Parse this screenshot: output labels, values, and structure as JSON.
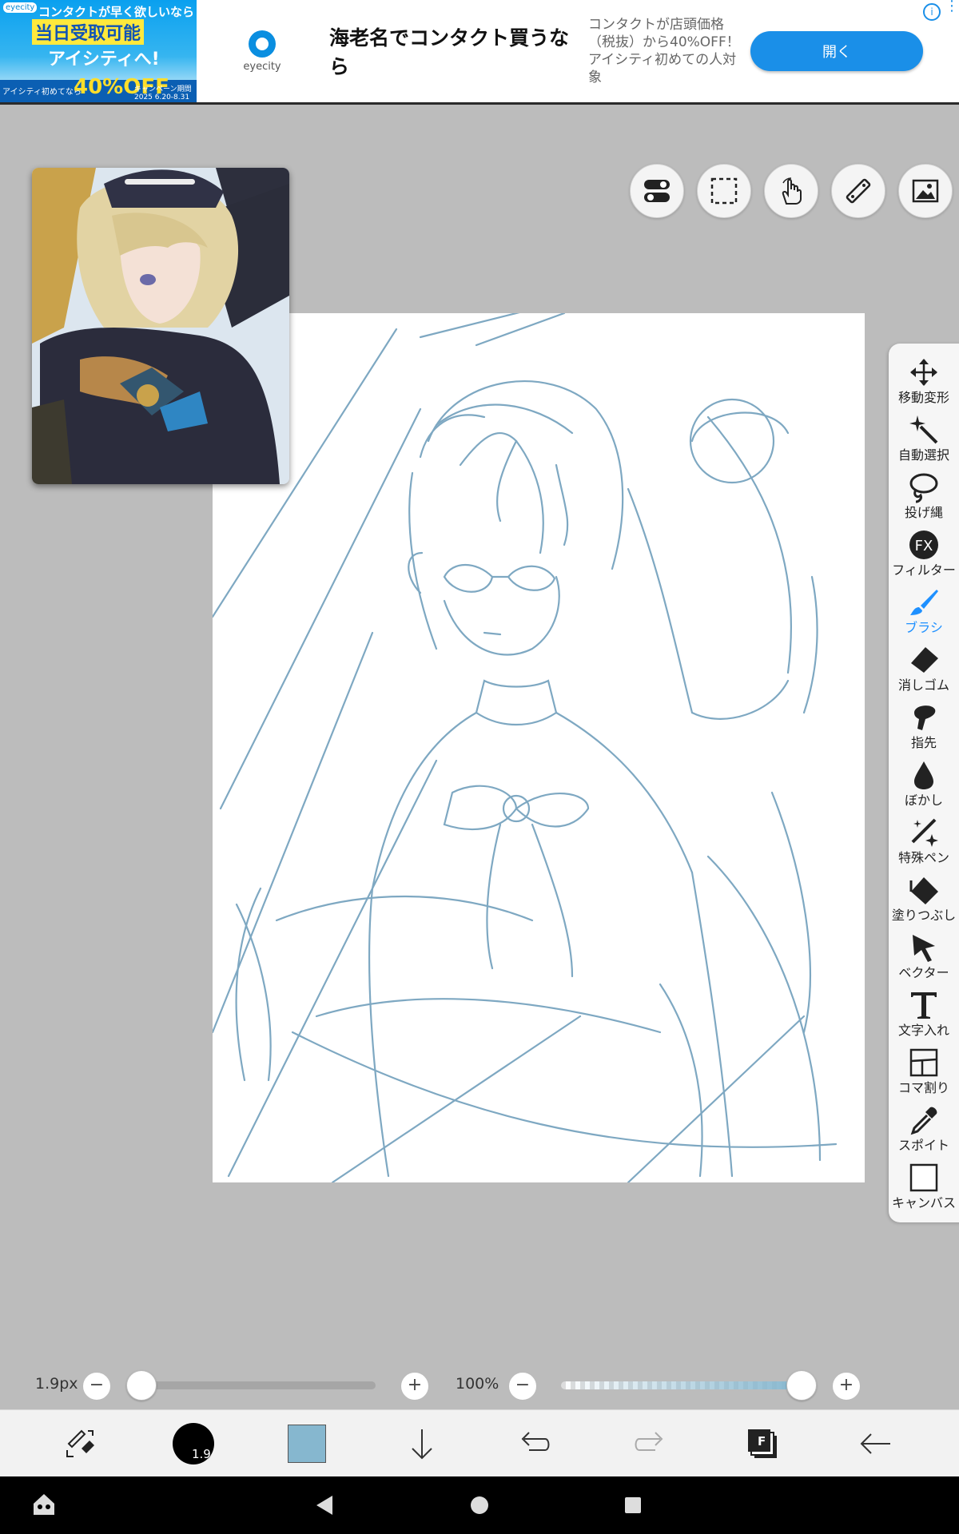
{
  "ad": {
    "brand_small": "eyecity",
    "image_line1": "コンタクトが早く欲しいなら",
    "image_line2": "当日受取可能",
    "image_line3": "アイシティへ!",
    "image_promo_left": "アイシティ初めてなら",
    "image_promo_big": "40%OFF",
    "image_promo_right": "キャンペーン期間 2025 6.20-8.31",
    "logo_text": "eyecity",
    "title": "海老名でコンタクト買うなら",
    "description": "コンタクトが店頭価格（税抜）から40%OFF！アイシティ初めての人対象",
    "button_label": "開く",
    "info_icon": "i"
  },
  "tools": [
    {
      "name": "move",
      "label": "移動変形",
      "icon": "move-icon"
    },
    {
      "name": "auto-select",
      "label": "自動選択",
      "icon": "magic-wand-icon"
    },
    {
      "name": "lasso",
      "label": "投げ縄",
      "icon": "lasso-icon"
    },
    {
      "name": "filter",
      "label": "フィルター",
      "icon": "fx-icon"
    },
    {
      "name": "brush",
      "label": "ブラシ",
      "icon": "brush-icon"
    },
    {
      "name": "eraser",
      "label": "消しゴム",
      "icon": "eraser-icon"
    },
    {
      "name": "finger",
      "label": "指先",
      "icon": "finger-icon"
    },
    {
      "name": "blur",
      "label": "ぼかし",
      "icon": "drop-icon"
    },
    {
      "name": "special-pen",
      "label": "特殊ペン",
      "icon": "sparkle-pen-icon"
    },
    {
      "name": "fill",
      "label": "塗りつぶし",
      "icon": "bucket-icon"
    },
    {
      "name": "vector",
      "label": "ベクター",
      "icon": "cursor-icon"
    },
    {
      "name": "text",
      "label": "文字入れ",
      "icon": "text-icon"
    },
    {
      "name": "frame",
      "label": "コマ割り",
      "icon": "frame-icon"
    },
    {
      "name": "eyedropper",
      "label": "スポイト",
      "icon": "eyedropper-icon"
    },
    {
      "name": "canvas",
      "label": "キャンバス",
      "icon": "canvas-icon"
    }
  ],
  "active_tool": "brush",
  "brush": {
    "size_label": "1.9px",
    "size_value": 0.02,
    "opacity_label": "100%",
    "opacity_value": 1.0,
    "badge": "1.9"
  },
  "colors": {
    "accent": "#1e90ff",
    "current_color": "#86b7cf",
    "sketch_stroke": "#7ea8c2"
  },
  "bottombar": {
    "layers_badge": "F"
  }
}
